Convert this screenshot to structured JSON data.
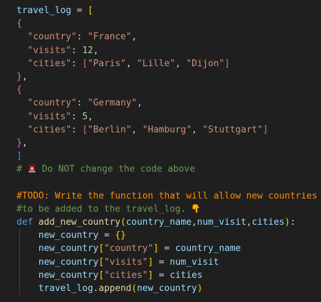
{
  "editor": {
    "colors": {
      "background": "#1f1f1f",
      "variable": "#9cdcfe",
      "operator": "#d4d4d4",
      "bracket_gold": "#ffd700",
      "bracket_purple": "#da70d6",
      "bracket_blue": "#179fff",
      "string": "#ce9178",
      "number": "#b5cea8",
      "comment": "#6a9955",
      "todo": "#ff8c00",
      "keyword": "#569cd6",
      "function": "#dcdcaa",
      "bracket_mismatch": "#e06c75"
    },
    "icons": [
      "siren-icon",
      "pointing-down-hand-icon"
    ],
    "lines": [
      [
        {
          "t": "travel_log",
          "c": "variable"
        },
        {
          "t": " = ",
          "c": "operator"
        },
        {
          "t": "[",
          "c": "bracket_gold"
        }
      ],
      [
        {
          "t": "{",
          "c": "bracket_purple"
        }
      ],
      [
        {
          "t": "  ",
          "c": "operator"
        },
        {
          "t": "\"country\"",
          "c": "string"
        },
        {
          "t": ": ",
          "c": "operator"
        },
        {
          "t": "\"France\"",
          "c": "string"
        },
        {
          "t": ",",
          "c": "operator"
        }
      ],
      [
        {
          "t": "  ",
          "c": "operator"
        },
        {
          "t": "\"visits\"",
          "c": "string"
        },
        {
          "t": ": ",
          "c": "operator"
        },
        {
          "t": "12",
          "c": "number"
        },
        {
          "t": ",",
          "c": "operator"
        }
      ],
      [
        {
          "t": "  ",
          "c": "operator"
        },
        {
          "t": "\"cities\"",
          "c": "string"
        },
        {
          "t": ": ",
          "c": "operator"
        },
        {
          "t": "[",
          "c": "bracket_mismatch"
        },
        {
          "t": "\"Paris\"",
          "c": "string"
        },
        {
          "t": ", ",
          "c": "operator"
        },
        {
          "t": "\"Lille\"",
          "c": "string"
        },
        {
          "t": ", ",
          "c": "operator"
        },
        {
          "t": "\"Dijon\"",
          "c": "string"
        },
        {
          "t": "]",
          "c": "bracket_mismatch"
        }
      ],
      [
        {
          "t": "}",
          "c": "bracket_purple"
        },
        {
          "t": ",",
          "c": "operator"
        }
      ],
      [
        {
          "t": "{",
          "c": "bracket_purple"
        }
      ],
      [
        {
          "t": "  ",
          "c": "operator"
        },
        {
          "t": "\"country\"",
          "c": "string"
        },
        {
          "t": ": ",
          "c": "operator"
        },
        {
          "t": "\"Germany\"",
          "c": "string"
        },
        {
          "t": ",",
          "c": "operator"
        }
      ],
      [
        {
          "t": "  ",
          "c": "operator"
        },
        {
          "t": "\"visits\"",
          "c": "string"
        },
        {
          "t": ": ",
          "c": "operator"
        },
        {
          "t": "5",
          "c": "number"
        },
        {
          "t": ",",
          "c": "operator"
        }
      ],
      [
        {
          "t": "  ",
          "c": "operator"
        },
        {
          "t": "\"cities\"",
          "c": "string"
        },
        {
          "t": ": ",
          "c": "operator"
        },
        {
          "t": "[",
          "c": "bracket_mismatch"
        },
        {
          "t": "\"Berlin\"",
          "c": "string"
        },
        {
          "t": ", ",
          "c": "operator"
        },
        {
          "t": "\"Hamburg\"",
          "c": "string"
        },
        {
          "t": ", ",
          "c": "operator"
        },
        {
          "t": "\"Stuttgart\"",
          "c": "string"
        },
        {
          "t": "]",
          "c": "bracket_mismatch"
        }
      ],
      [
        {
          "t": "}",
          "c": "bracket_purple"
        },
        {
          "t": ",",
          "c": "operator"
        }
      ],
      [
        {
          "t": "]",
          "c": "bracket_blue"
        }
      ],
      [
        {
          "t": "# ",
          "c": "comment"
        },
        {
          "icon": "siren-icon"
        },
        {
          "t": " Do NOT change the code above",
          "c": "comment"
        }
      ],
      [],
      [
        {
          "t": "#TODO: Write the function that will allow new countries",
          "c": "todo"
        }
      ],
      [
        {
          "t": "#to be added to the travel_log. ",
          "c": "comment"
        },
        {
          "icon": "pointing-down-hand-icon"
        }
      ],
      [
        {
          "t": "def ",
          "c": "keyword"
        },
        {
          "t": "add_new_country",
          "c": "function"
        },
        {
          "t": "(",
          "c": "bracket_gold"
        },
        {
          "t": "country_name",
          "c": "variable"
        },
        {
          "t": ",",
          "c": "operator"
        },
        {
          "t": "num_visit",
          "c": "variable"
        },
        {
          "t": ",",
          "c": "operator"
        },
        {
          "t": "cities",
          "c": "variable"
        },
        {
          "t": ")",
          "c": "bracket_gold"
        },
        {
          "t": ":",
          "c": "operator"
        }
      ],
      [
        {
          "t": "    ",
          "c": "operator"
        },
        {
          "t": "new_country",
          "c": "variable"
        },
        {
          "t": " = ",
          "c": "operator"
        },
        {
          "t": "{}",
          "c": "bracket_gold"
        }
      ],
      [
        {
          "t": "    ",
          "c": "operator"
        },
        {
          "t": "new_country",
          "c": "variable"
        },
        {
          "t": "[",
          "c": "bracket_gold"
        },
        {
          "t": "\"country\"",
          "c": "string"
        },
        {
          "t": "]",
          "c": "bracket_gold"
        },
        {
          "t": " = ",
          "c": "operator"
        },
        {
          "t": "country_name",
          "c": "variable"
        }
      ],
      [
        {
          "t": "    ",
          "c": "operator"
        },
        {
          "t": "new_country",
          "c": "variable"
        },
        {
          "t": "[",
          "c": "bracket_gold"
        },
        {
          "t": "\"visits\"",
          "c": "string"
        },
        {
          "t": "]",
          "c": "bracket_gold"
        },
        {
          "t": " = ",
          "c": "operator"
        },
        {
          "t": "num_visit",
          "c": "variable"
        }
      ],
      [
        {
          "t": "    ",
          "c": "operator"
        },
        {
          "t": "new_country",
          "c": "variable"
        },
        {
          "t": "[",
          "c": "bracket_gold"
        },
        {
          "t": "\"cities\"",
          "c": "string"
        },
        {
          "t": "]",
          "c": "bracket_gold"
        },
        {
          "t": " = ",
          "c": "operator"
        },
        {
          "t": "cities",
          "c": "variable"
        }
      ],
      [
        {
          "t": "    ",
          "c": "operator"
        },
        {
          "t": "travel_log",
          "c": "variable"
        },
        {
          "t": ".",
          "c": "operator"
        },
        {
          "t": "append",
          "c": "function"
        },
        {
          "t": "(",
          "c": "bracket_gold"
        },
        {
          "t": "new_country",
          "c": "variable"
        },
        {
          "t": ")",
          "c": "bracket_gold"
        }
      ]
    ]
  }
}
